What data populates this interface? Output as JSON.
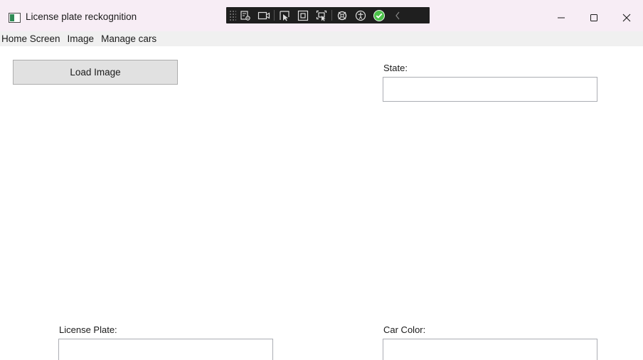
{
  "window": {
    "title": "License plate reckognition",
    "icon": "app-window-icon",
    "controls": {
      "minimize_icon": "minimize-icon",
      "maximize_icon": "maximize-icon",
      "close_icon": "close-icon"
    }
  },
  "debug_toolbar": {
    "icons": [
      "live-visual-tree-icon",
      "video-record-icon",
      "select-element-icon",
      "display-layout-adorners-icon",
      "track-focused-element-icon",
      "hot-reload-icon",
      "accessibility-checker-icon",
      "status-ok-icon",
      "collapse-chevron-icon"
    ],
    "status_color": "#4cc24a"
  },
  "menu": {
    "items": [
      {
        "label": "Home Screen"
      },
      {
        "label": "Image"
      },
      {
        "label": "Manage cars"
      }
    ]
  },
  "main": {
    "load_image_label": "Load Image",
    "state_label": "State:",
    "state_value": "",
    "plate_label": "License Plate:",
    "plate_value": "",
    "color_label": "Car Color:",
    "color_value": ""
  },
  "colors": {
    "titlebar_bg": "#f7edf5",
    "menubar_bg": "#f0f0f0",
    "button_bg": "#e1e1e1",
    "toolbar_bg": "#1f1f1f"
  }
}
